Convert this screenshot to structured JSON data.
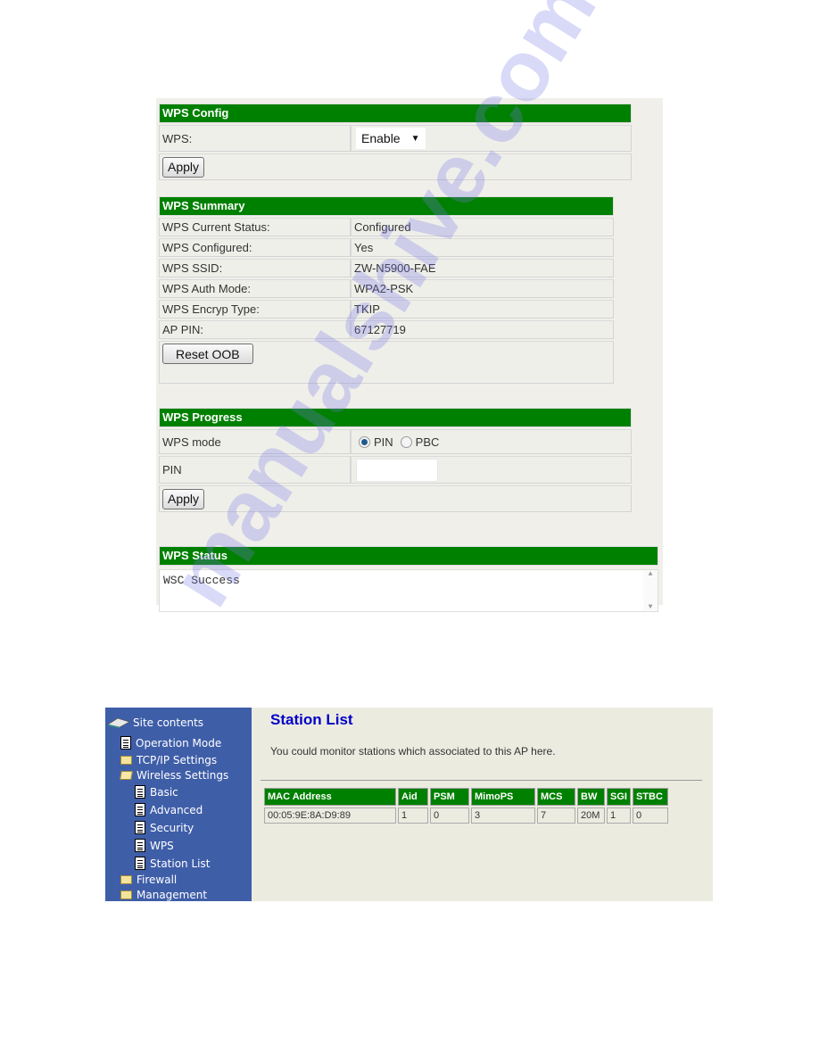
{
  "wps_config": {
    "header": "WPS Config",
    "wps_label": "WPS:",
    "wps_value": "Enable",
    "apply_label": "Apply"
  },
  "wps_summary": {
    "header": "WPS Summary",
    "rows": [
      {
        "label": "WPS Current Status:",
        "value": "Configured"
      },
      {
        "label": "WPS Configured:",
        "value": "Yes"
      },
      {
        "label": "WPS SSID:",
        "value": "ZW-N5900-FAE"
      },
      {
        "label": "WPS Auth Mode:",
        "value": "WPA2-PSK"
      },
      {
        "label": "WPS Encryp Type:",
        "value": "TKIP"
      },
      {
        "label": "AP PIN:",
        "value": "67127719"
      }
    ],
    "reset_label": "Reset OOB"
  },
  "wps_progress": {
    "header": "WPS Progress",
    "mode_label": "WPS mode",
    "mode_options": [
      "PIN",
      "PBC"
    ],
    "mode_selected": "PIN",
    "pin_label": "PIN",
    "pin_value": "",
    "apply_label": "Apply"
  },
  "wps_status": {
    "header": "WPS Status",
    "text": "WSC Success"
  },
  "sidebar": {
    "root": "Site contents",
    "items": [
      {
        "label": "Operation Mode",
        "icon": "document-icon"
      },
      {
        "label": "TCP/IP Settings",
        "icon": "folder-icon"
      },
      {
        "label": "Wireless Settings",
        "icon": "folder-open-icon"
      },
      {
        "label": "Basic",
        "icon": "document-icon"
      },
      {
        "label": "Advanced",
        "icon": "document-icon"
      },
      {
        "label": "Security",
        "icon": "document-icon"
      },
      {
        "label": "WPS",
        "icon": "document-icon"
      },
      {
        "label": "Station List",
        "icon": "document-icon"
      },
      {
        "label": "Firewall",
        "icon": "folder-icon"
      },
      {
        "label": "Management",
        "icon": "folder-icon"
      }
    ]
  },
  "station_list": {
    "title": "Station List",
    "description": "You could monitor stations which associated to this AP here.",
    "columns": [
      "MAC Address",
      "Aid",
      "PSM",
      "MimoPS",
      "MCS",
      "BW",
      "SGI",
      "STBC"
    ],
    "rows": [
      [
        "00:05:9E:8A:D9:89",
        "1",
        "0",
        "3",
        "7",
        "20M",
        "1",
        "0"
      ]
    ]
  },
  "watermark": "manualshive.com",
  "colors": {
    "header_green": "#008000",
    "sidebar_blue": "#3f5ea8",
    "title_blue": "#0000c8"
  }
}
